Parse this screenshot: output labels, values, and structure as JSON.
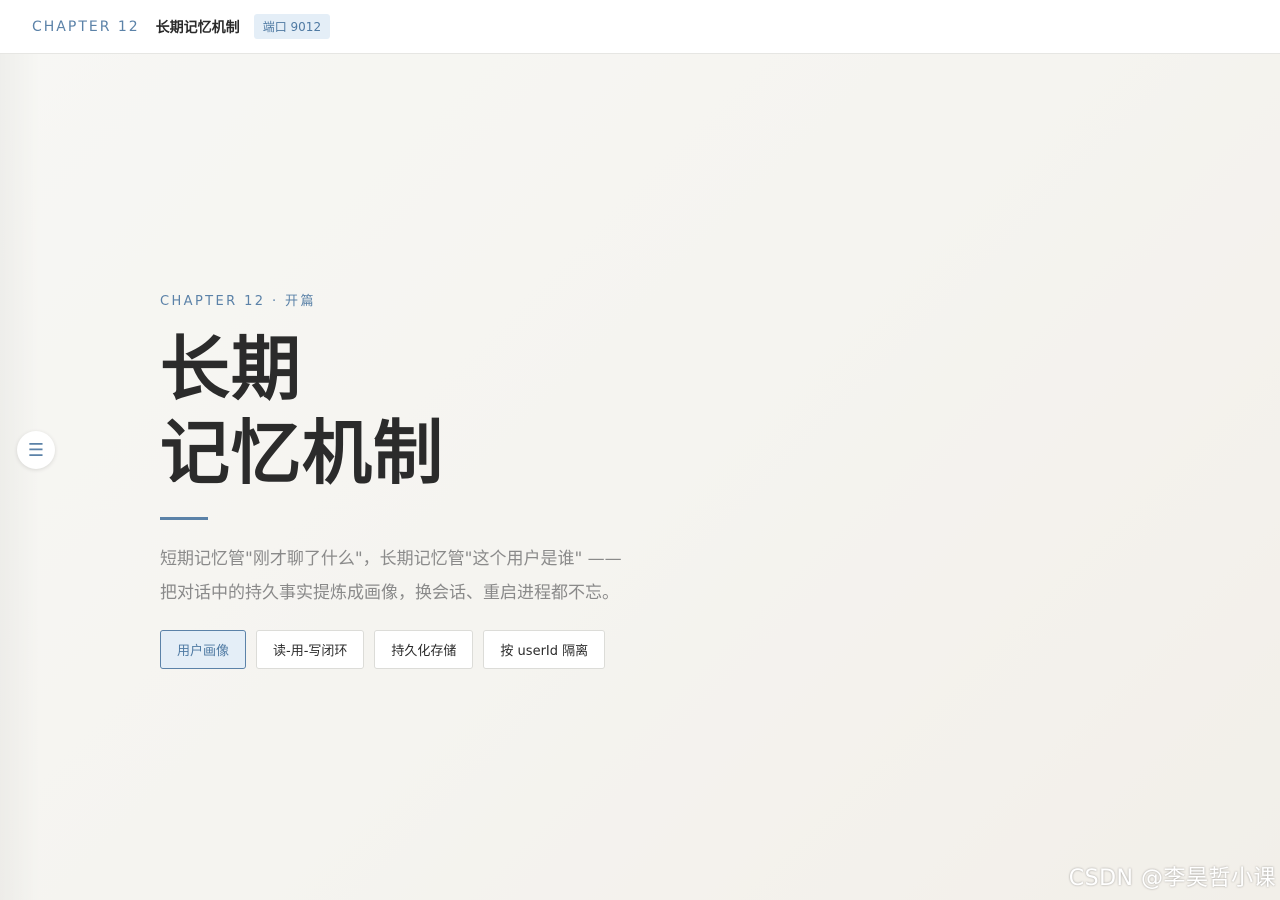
{
  "header": {
    "chapter": "CHAPTER 12",
    "title": "长期记忆机制",
    "port_badge": "端口 9012"
  },
  "toc_button": {
    "icon": "menu-icon",
    "glyph": "☰"
  },
  "hero": {
    "eyebrow": "CHAPTER 12 · 开篇",
    "headline_line1": "长期",
    "headline_line2": "记忆机制",
    "description_line1": "短期记忆管\"刚才聊了什么\"，长期记忆管\"这个用户是谁\" ——",
    "description_line2": "把对话中的持久事实提炼成画像，换会话、重启进程都不忘。",
    "tags": [
      {
        "label": "用户画像",
        "active": true
      },
      {
        "label": "读-用-写闭环",
        "active": false
      },
      {
        "label": "持久化存储",
        "active": false
      },
      {
        "label": "按 userId 隔离",
        "active": false
      }
    ]
  },
  "watermark": "CSDN @李昊哲小课",
  "colors": {
    "accent": "#5b82a8",
    "accent_bg": "#e4eef7",
    "text_dark": "#2b2b2b",
    "text_muted": "#8a8a8a"
  }
}
